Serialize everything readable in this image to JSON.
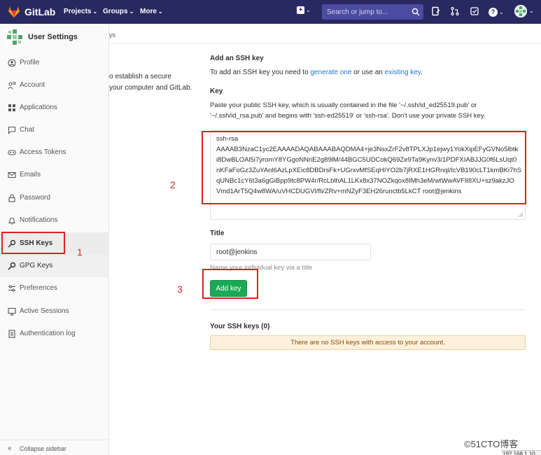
{
  "navbar": {
    "brand": "GitLab",
    "menus": [
      {
        "label": "Projects",
        "caret": "⌄"
      },
      {
        "label": "Groups",
        "caret": "⌄"
      },
      {
        "label": "More",
        "caret": "⌄"
      }
    ],
    "new_caret": "⌄",
    "search_placeholder": "Search or jump to...",
    "help_caret": "⌄",
    "avatar_caret": "⌄",
    "bg_color": "#292961"
  },
  "sidebar": {
    "title": "User Settings",
    "items": [
      {
        "label": "Profile",
        "icon": "profile-icon"
      },
      {
        "label": "Account",
        "icon": "account-icon"
      },
      {
        "label": "Applications",
        "icon": "applications-icon"
      },
      {
        "label": "Chat",
        "icon": "chat-icon"
      },
      {
        "label": "Access Tokens",
        "icon": "access-tokens-icon"
      },
      {
        "label": "Emails",
        "icon": "emails-icon"
      },
      {
        "label": "Password",
        "icon": "password-icon"
      },
      {
        "label": "Notifications",
        "icon": "notifications-icon"
      },
      {
        "label": "SSH Keys",
        "icon": "ssh-keys-icon",
        "active": true
      },
      {
        "label": "GPG Keys",
        "icon": "gpg-keys-icon"
      },
      {
        "label": "Preferences",
        "icon": "preferences-icon"
      },
      {
        "label": "Active Sessions",
        "icon": "active-sessions-icon"
      },
      {
        "label": "Authentication log",
        "icon": "authentication-log-icon"
      }
    ],
    "collapse_label": "Collapse sidebar",
    "collapse_icon": "«"
  },
  "left_column": {
    "breadcrumb_fragment": "ys",
    "text_line1": "o establish a secure",
    "text_line2": "your computer and GitLab."
  },
  "form": {
    "heading": "Add an SSH key",
    "intro_before": "To add an SSH key you need to ",
    "intro_link1": "generate one",
    "intro_middle": " or use an ",
    "intro_link2": "existing key",
    "intro_after": ".",
    "key_label": "Key",
    "key_help_line1": "Paste your public SSH key, which is usually contained in the file '~/.ssh/id_ed25519.pub' or",
    "key_help_line2": "'~/.ssh/id_rsa.pub' and begins with 'ssh-ed25519' or 'ssh-rsa'. Don't use your private SSH key.",
    "key_value_lines": [
      "ssh-rsa",
      "AAAAB3NzaC1yc2EAAAADAQABAAABAQDMA4+je3NsxZrF2v8TPLXJp1ejwy1YokXipEFyGVNo5lbtk",
      "i8DwBLOAl5i7yromY8YGgoNNriE2g89lM/44BGC5UDCokQ69Ze9Ta9Kynv3/1PDFXIABJJG0f6LsUqt0",
      "nKFaFoGz3ZuYAnl6AzLpXEic8DBDrsFk+UGrxvMfSEqHIYO2b7jRXE1HGRnql/IcVB190cLT1kmBKi7hS",
      "qUNBc1cY6t3a6gGiBpp9tc8PW4r/RcLblhAL1LKx8x37NOZkqox8IMh3eM/wtWwAVFlI8XU+sz9akzJO",
      "Vmd1ArT5Q4w8WA/uVHCDUGVl/fli/ZRv+mNZyF3EH26runctb5LkCT root@jenkins"
    ],
    "title_label": "Title",
    "title_value": "root@jenkins",
    "title_hint": "Name your individual key via a title",
    "add_button": "Add key",
    "your_keys_heading": "Your SSH keys (0)",
    "no_keys_message": "There are no SSH keys with access to your account."
  },
  "annotations": [
    "1",
    "2",
    "3"
  ],
  "watermark": "©51CTO博客",
  "screen_fragment": "192.168.1.10",
  "colors": {
    "annotation_red": "#e02020",
    "button_green": "#1aaa55",
    "link_blue": "#1f78d1",
    "warning_bg": "#fdf1dd"
  }
}
